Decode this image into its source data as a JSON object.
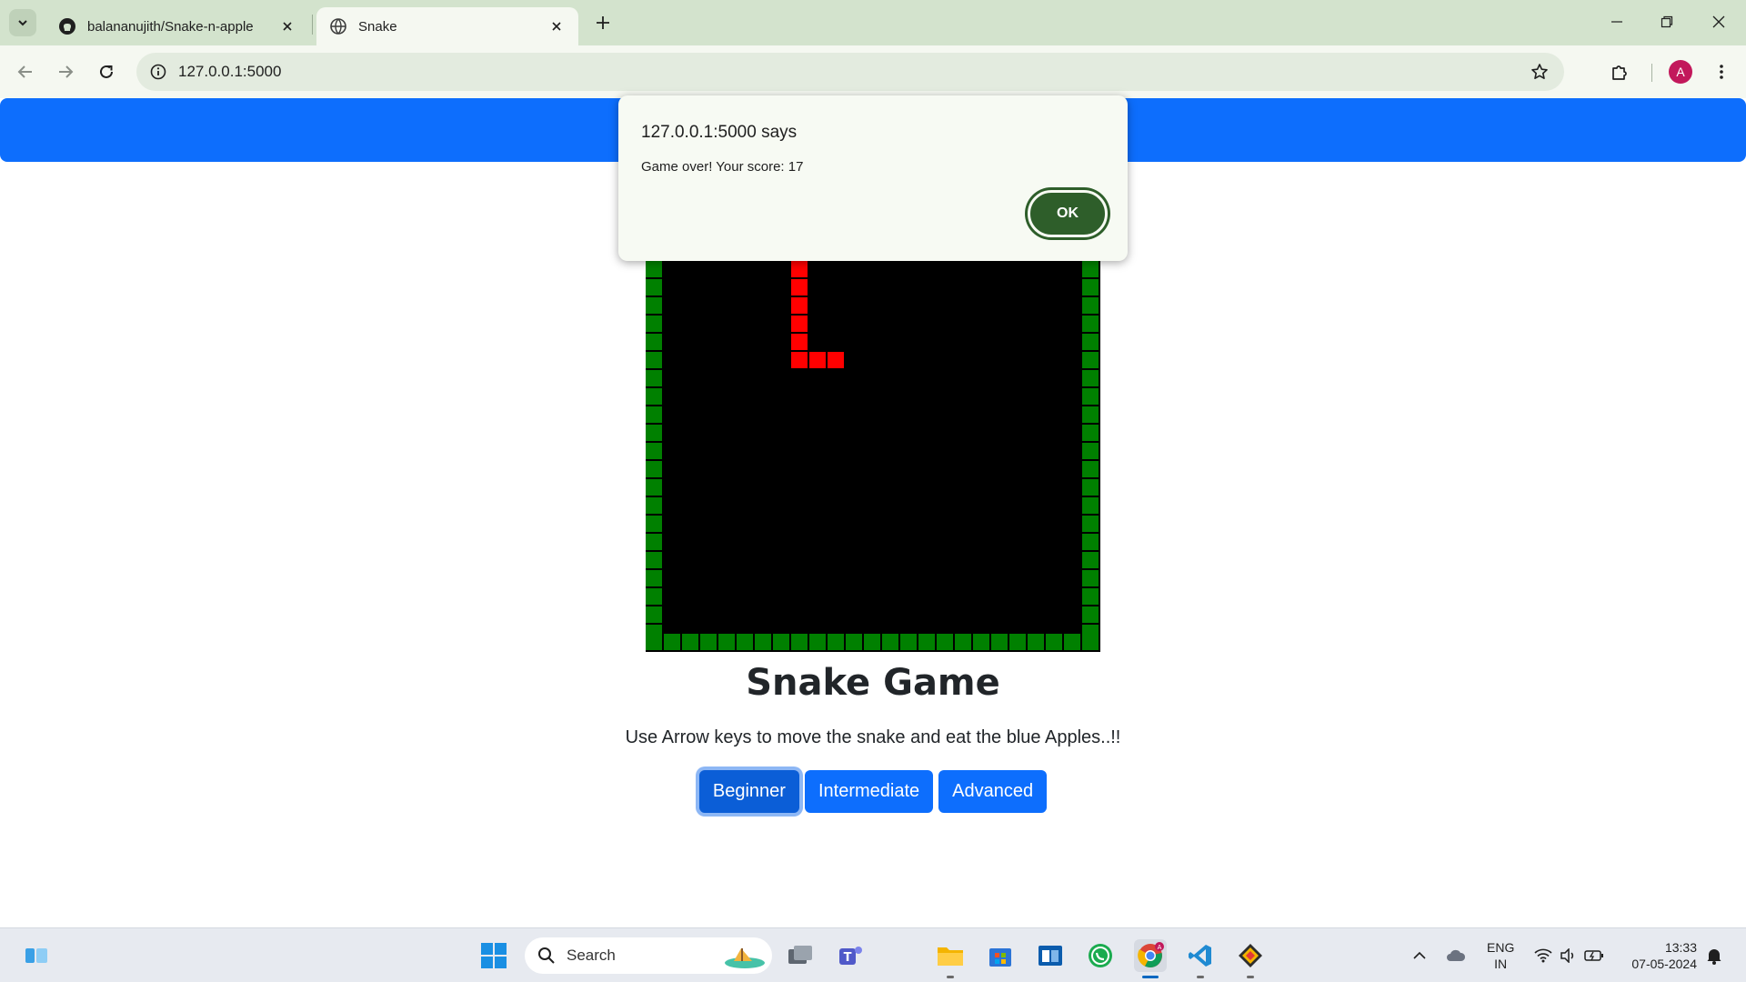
{
  "browser": {
    "tabs": [
      {
        "title": "balananujith/Snake-n-apple",
        "active": false
      },
      {
        "title": "Snake",
        "active": true
      }
    ],
    "url": "127.0.0.1:5000",
    "profile_initial": "A"
  },
  "dialog": {
    "title": "127.0.0.1:5000 says",
    "message": "Game over! Your score: 17",
    "ok_label": "OK"
  },
  "game": {
    "title": "Snake Game",
    "instructions": "Use Arrow keys to move the snake and eat the blue Apples..!!",
    "levels": [
      {
        "label": "Beginner",
        "selected": true
      },
      {
        "label": "Intermediate",
        "selected": false
      },
      {
        "label": "Advanced",
        "selected": false
      }
    ],
    "colors": {
      "snake": "#ff0000",
      "wall": "#008000",
      "board": "#000000",
      "navbar": "#0d6efd"
    }
  },
  "taskbar": {
    "search_label": "Search",
    "language": "ENG",
    "region": "IN",
    "time": "13:33",
    "date": "07-05-2024"
  }
}
